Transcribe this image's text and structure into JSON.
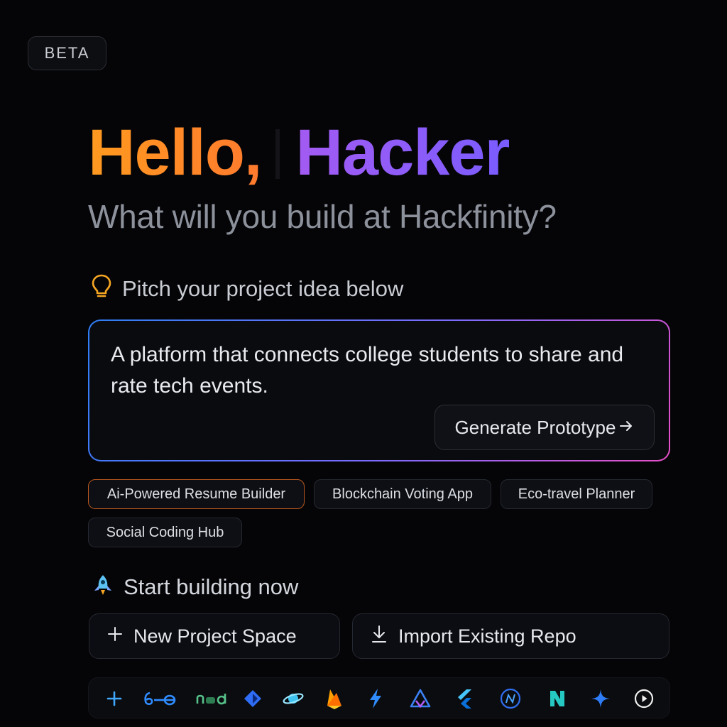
{
  "badge": {
    "label": "BETA"
  },
  "hero": {
    "greeting": "Hello,",
    "name": "Hacker",
    "subtitle": "What will you build at Hackfinity?"
  },
  "pitch": {
    "label": "Pitch your project idea below",
    "icon": "lightbulb-icon",
    "input_value": "A platform that connects college students to share and rate tech events.",
    "generate_label": "Generate Prototype"
  },
  "suggestions": [
    {
      "label": "Ai-Powered Resume Builder",
      "active": true
    },
    {
      "label": "Blockchain Voting App",
      "active": false
    },
    {
      "label": "Eco-travel Planner",
      "active": false
    },
    {
      "label": "Social Coding Hub",
      "active": false
    }
  ],
  "start": {
    "label": "Start building now",
    "icon": "rocket-icon",
    "new_project_label": "New Project Space",
    "import_label": "Import Existing Repo"
  },
  "toolbar": {
    "icons": [
      "plus-icon",
      "sixty-six-logo-icon",
      "node-logo-icon",
      "diamond-logo-icon",
      "planet-logo-icon",
      "firebase-logo-icon",
      "bolt-logo-icon",
      "triangle-logo-icon",
      "flutter-logo-icon",
      "circle-n-logo-icon",
      "n-logo-icon",
      "sparkle-icon",
      "play-circle-icon"
    ]
  },
  "colors": {
    "accent_orange": "#ff8a24",
    "accent_purple": "#8f5cf6",
    "border_gradient_start": "#2f7df6",
    "border_gradient_end": "#e64fc7"
  }
}
